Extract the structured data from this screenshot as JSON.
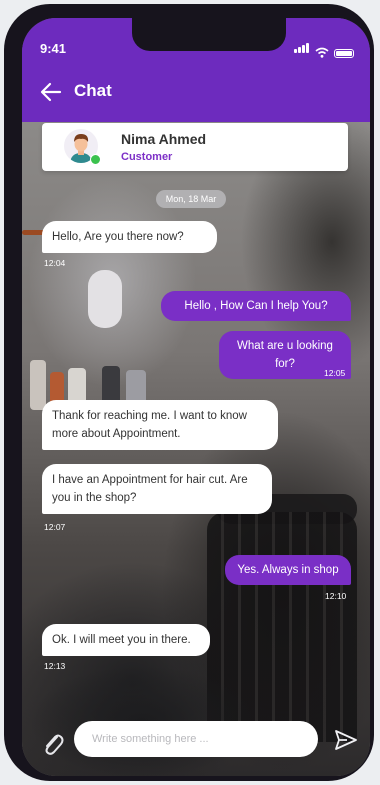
{
  "status_bar": {
    "time": "9:41"
  },
  "header": {
    "title": "Chat"
  },
  "contact": {
    "name": "Nima Ahmed",
    "role": "Customer"
  },
  "date_divider": "Mon, 18 Mar",
  "messages": [
    {
      "text": "Hello, Are you there now?",
      "direction": "incoming"
    },
    {
      "text": "12:04",
      "kind": "timestamp"
    },
    {
      "text": "Hello , How Can I help You?",
      "direction": "outgoing"
    },
    {
      "text": "What are u looking for?",
      "direction": "outgoing"
    },
    {
      "text": "12:05",
      "kind": "timestamp"
    },
    {
      "text": "Thank for reaching me. I want to know more about  Appointment.",
      "direction": "incoming"
    },
    {
      "text": "I have an Appointment for hair cut. Are you in the shop?",
      "direction": "incoming"
    },
    {
      "text": "12:07",
      "kind": "timestamp"
    },
    {
      "text": "Yes. Always in shop",
      "direction": "outgoing"
    },
    {
      "text": "12:10",
      "kind": "timestamp"
    },
    {
      "text": "Ok. I will meet you in there.",
      "direction": "incoming"
    },
    {
      "text": "12:13",
      "kind": "timestamp"
    }
  ],
  "composer": {
    "placeholder": "Write something here ..."
  },
  "icons": {
    "back": "arrow-left-icon",
    "attach": "paperclip-icon",
    "send": "send-icon"
  },
  "colors": {
    "primary": "#6d2bbe",
    "bubble_out": "#7a2fc6",
    "role_text": "#7d2fc7"
  }
}
